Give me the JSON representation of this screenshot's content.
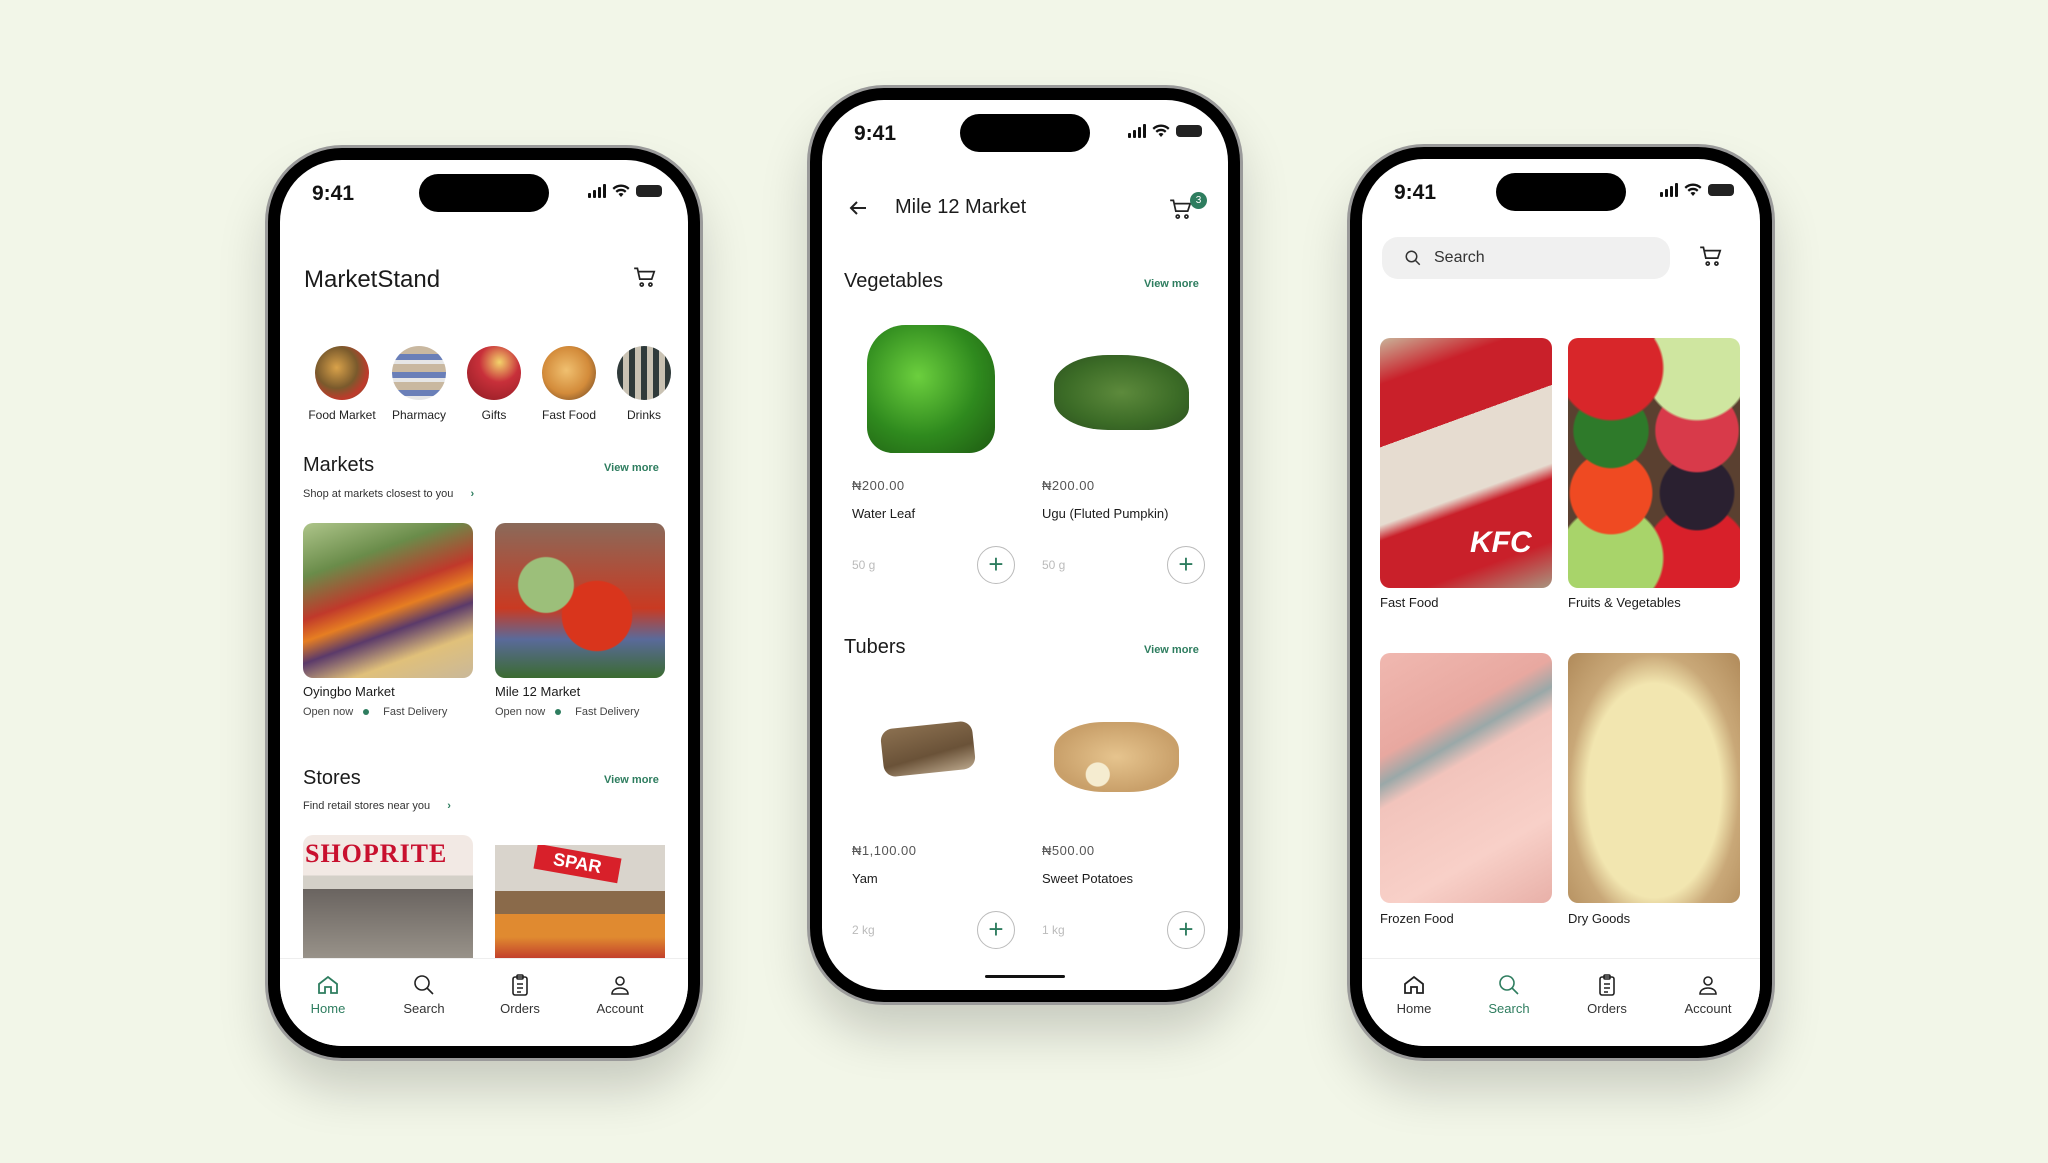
{
  "colors": {
    "accent": "#2e7d5f",
    "background": "#f2f6e8"
  },
  "status_bar": {
    "time": "9:41"
  },
  "phone_home": {
    "title": "MarketStand",
    "cart_icon": "cart-icon",
    "categories": [
      {
        "label": "Food Market"
      },
      {
        "label": "Pharmacy"
      },
      {
        "label": "Gifts"
      },
      {
        "label": "Fast Food"
      },
      {
        "label": "Drinks"
      }
    ],
    "markets": {
      "title": "Markets",
      "view_more": "View more",
      "subtitle": "Shop at markets closest to you",
      "items": [
        {
          "name": "Oyingbo Market",
          "status": "Open now",
          "delivery": "Fast Delivery"
        },
        {
          "name": "Mile 12 Market",
          "status": "Open now",
          "delivery": "Fast Delivery"
        }
      ]
    },
    "stores": {
      "title": "Stores",
      "view_more": "View more",
      "subtitle": "Find retail stores near you",
      "items": [
        {
          "name": "Shoprite",
          "sign": "SHOPRITE"
        },
        {
          "name": "Spar",
          "sign": "SPAR"
        }
      ]
    }
  },
  "phone_market": {
    "title": "Mile 12 Market",
    "cart_count": "3",
    "sections": [
      {
        "title": "Vegetables",
        "view_more": "View more",
        "items": [
          {
            "price": "₦200.00",
            "name": "Water Leaf",
            "weight": "50 g"
          },
          {
            "price": "₦200.00",
            "name": "Ugu (Fluted Pumpkin)",
            "weight": "50 g"
          }
        ]
      },
      {
        "title": "Tubers",
        "view_more": "View more",
        "items": [
          {
            "price": "₦1,100.00",
            "name": "Yam",
            "weight": "2 kg"
          },
          {
            "price": "₦500.00",
            "name": "Sweet Potatoes",
            "weight": "1 kg"
          }
        ]
      }
    ],
    "add_label": "+"
  },
  "phone_search": {
    "search_placeholder": "Search",
    "categories": [
      {
        "label": "Fast Food",
        "sign": "KFC"
      },
      {
        "label": "Fruits & Vegetables"
      },
      {
        "label": "Frozen Food"
      },
      {
        "label": "Dry Goods"
      }
    ]
  },
  "nav": {
    "items": [
      {
        "label": "Home"
      },
      {
        "label": "Search"
      },
      {
        "label": "Orders"
      },
      {
        "label": "Account"
      }
    ]
  }
}
